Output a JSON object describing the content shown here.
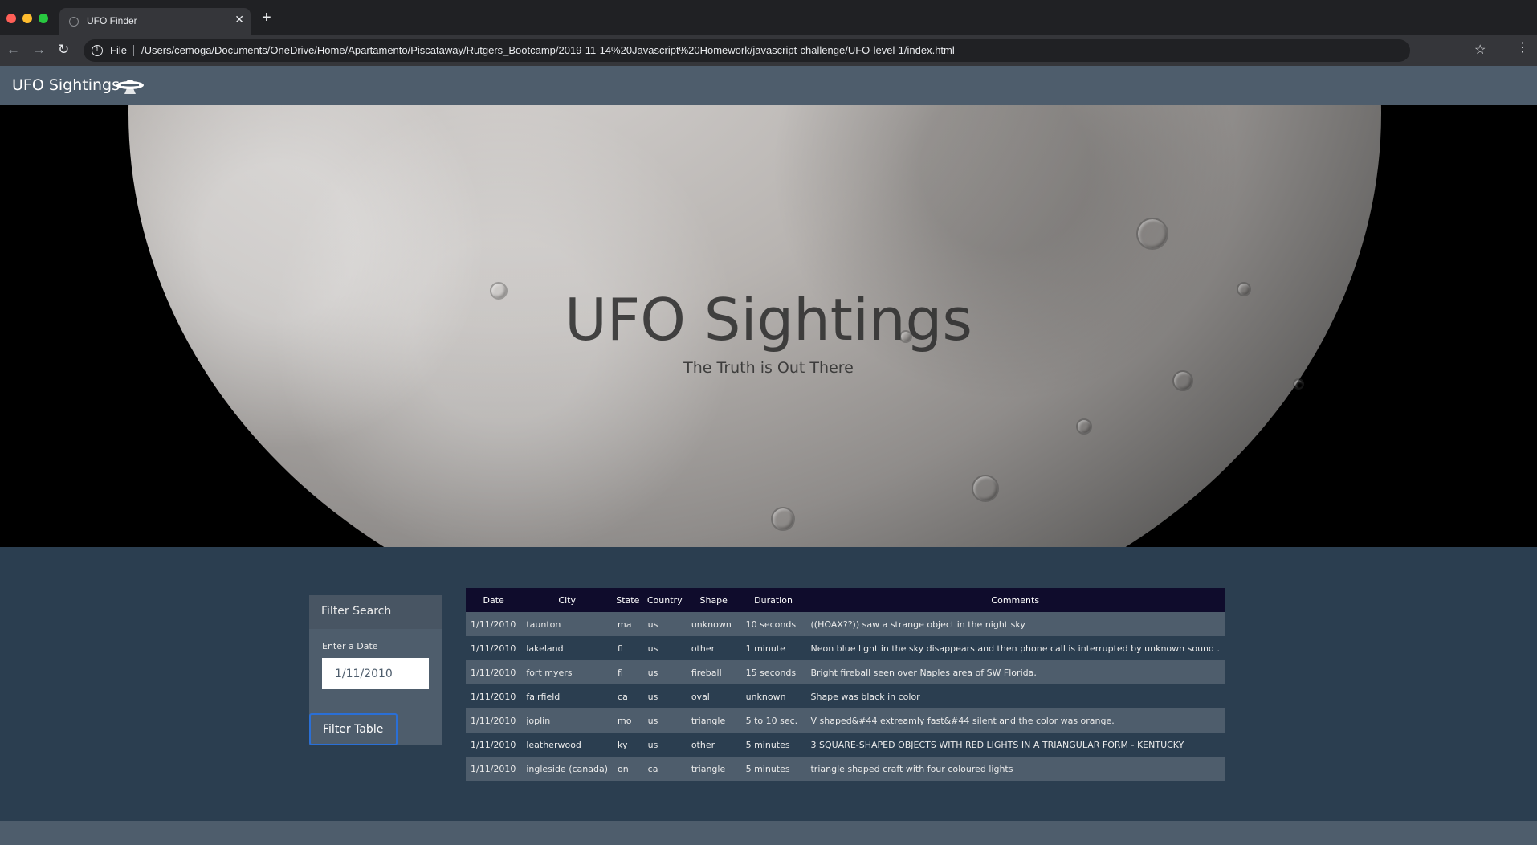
{
  "browser": {
    "tab_title": "UFO Finder",
    "scheme": "File",
    "url": "/Users/cemoga/Documents/OneDrive/Home/Apartamento/Piscataway/Rutgers_Bootcamp/2019-11-14%20Javascript%20Homework/javascript-challenge/UFO-level-1/index.html",
    "traffic_colors": [
      "#ff5f57",
      "#febc2e",
      "#28c840"
    ]
  },
  "navbar": {
    "brand": "UFO Sightings",
    "icon": "ufo-icon"
  },
  "hero": {
    "title": "UFO Sightings",
    "subtitle": "The Truth is Out There"
  },
  "filter": {
    "heading": "Filter Search",
    "date_label": "Enter a Date",
    "date_value": "1/11/2010",
    "button_label": "Filter Table"
  },
  "table": {
    "headers": [
      "Date",
      "City",
      "State",
      "Country",
      "Shape",
      "Duration",
      "Comments"
    ],
    "rows": [
      [
        "1/11/2010",
        "taunton",
        "ma",
        "us",
        "unknown",
        "10 seconds",
        "((HOAX??)) saw a strange object in the night sky"
      ],
      [
        "1/11/2010",
        "lakeland",
        "fl",
        "us",
        "other",
        "1 minute",
        "Neon blue light in the sky disappears and then phone call is interrupted by unknown sound ."
      ],
      [
        "1/11/2010",
        "fort myers",
        "fl",
        "us",
        "fireball",
        "15 seconds",
        "Bright fireball seen over Naples area of SW Florida."
      ],
      [
        "1/11/2010",
        "fairfield",
        "ca",
        "us",
        "oval",
        "unknown",
        "Shape was black in color"
      ],
      [
        "1/11/2010",
        "joplin",
        "mo",
        "us",
        "triangle",
        "5 to 10 sec.",
        "V shaped&#44 extreamly fast&#44 silent and the color was orange."
      ],
      [
        "1/11/2010",
        "leatherwood",
        "ky",
        "us",
        "other",
        "5 minutes",
        "3 SQUARE-SHAPED OBJECTS WITH RED LIGHTS IN A TRIANGULAR FORM - KENTUCKY"
      ],
      [
        "1/11/2010",
        "ingleside (canada)",
        "on",
        "ca",
        "triangle",
        "5 minutes",
        "triangle shaped craft with four coloured lights"
      ]
    ]
  }
}
